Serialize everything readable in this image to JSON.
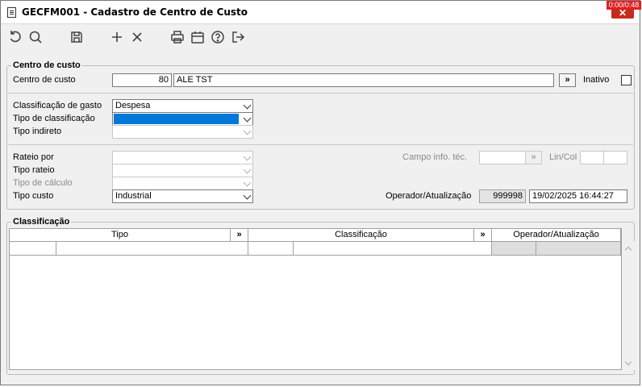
{
  "window": {
    "title": "GECFM001 - Cadastro de Centro de Custo",
    "timer": "0:00/0:48",
    "close_label": "✕"
  },
  "toolbar": {
    "icons": [
      "undo-icon",
      "search-icon",
      "save-icon",
      "add-icon",
      "delete-icon",
      "print-icon",
      "calendar-icon",
      "help-icon",
      "exit-icon"
    ]
  },
  "centro": {
    "legend": "Centro de custo",
    "label": "Centro de custo",
    "code": "80",
    "name": "ALE TST",
    "expand": "»",
    "inativo_label": "Inativo"
  },
  "classif": {
    "gasto_label": "Classificação de gasto",
    "gasto_value": "Despesa",
    "tipo_label": "Tipo de classificação",
    "tipo_value": "",
    "indireto_label": "Tipo indireto",
    "indireto_value": ""
  },
  "rateio": {
    "rateio_por_label": "Rateio por",
    "tipo_rateio_label": "Tipo rateio",
    "tipo_calculo_label": "Tipo de cálculo",
    "tipo_custo_label": "Tipo custo",
    "tipo_custo_value": "Industrial",
    "campo_label": "Campo info. téc.",
    "campo_button": "»",
    "lincol_label": "Lin/Col",
    "operador_label": "Operador/Atualização",
    "operador_value": "999998",
    "atualizacao_value": "19/02/2025 16:44:27"
  },
  "classificacao_grid": {
    "legend": "Classificação",
    "columns": [
      "Tipo",
      "Classificação",
      "Operador/Atualização"
    ],
    "expand": "»"
  },
  "colors": {
    "selection": "#0078d7",
    "timer_bg": "#e02020",
    "close_bg": "#c42b1c"
  }
}
